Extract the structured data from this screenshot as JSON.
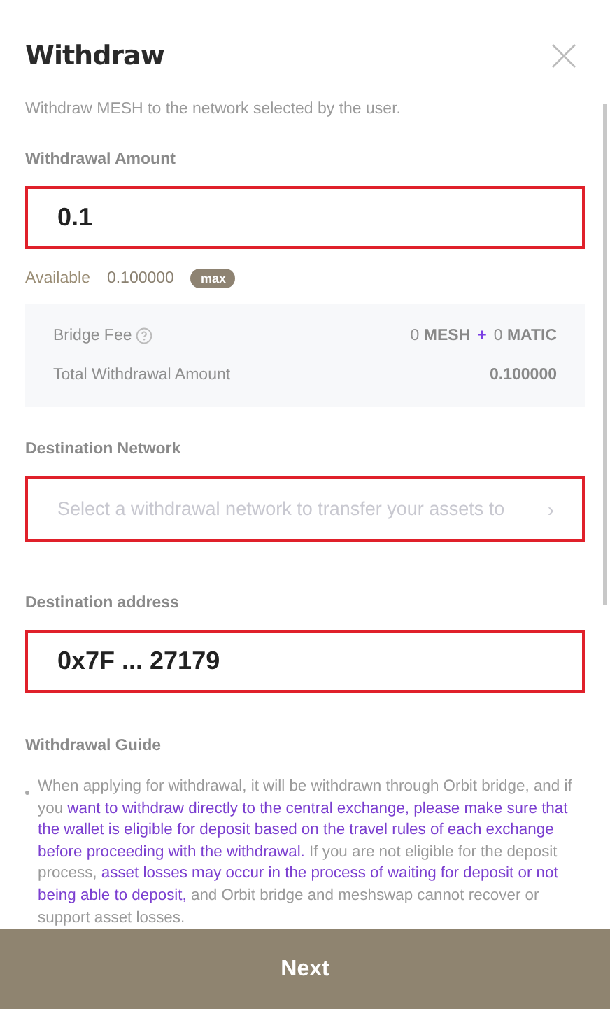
{
  "header": {
    "title": "Withdraw",
    "subtitle": "Withdraw MESH to the network selected by the user."
  },
  "amount": {
    "label": "Withdrawal Amount",
    "value": "0.1",
    "outlined": true,
    "available_label": "Available",
    "available_value": "0.100000",
    "max_button": "max"
  },
  "fees": [
    {
      "kind": "fee",
      "label": "Bridge Fee",
      "value_1": "0 **MESH**",
      "plus": "+",
      "value_2": "0 **MATIC**"
    },
    {
      "kind": "total",
      "label": "Total Withdrawal Amount",
      "value": "0.100000"
    }
  ],
  "network": {
    "label": "Destination Network",
    "placeholder": "Select a withdrawal network to transfer your assets to",
    "chevron": "›",
    "outlined": true
  },
  "address": {
    "label": "Destination address",
    "value": "0x7F ... 27179",
    "outlined": true
  },
  "guide": {
    "title": "Withdrawal Guide",
    "items": [
      {
        "segments": [
          {
            "text": "When applying for withdrawal, it will be withdrawn through Orbit bridge, and if you ",
            "highlight": false
          },
          {
            "text": "want to withdraw directly to the central exchange, please make sure that the wallet is eligible for deposit based on the travel rules of each exchange before proceeding with the withdrawal.",
            "highlight": true
          },
          {
            "text": " If you are not eligible for the deposit process, ",
            "highlight": false
          },
          {
            "text": "asset losses may occur in the process of waiting for deposit or not being able to deposit,",
            "highlight": true
          },
          {
            "text": " and Orbit bridge and meshswap cannot recover or support asset losses.",
            "highlight": false
          }
        ]
      }
    ]
  },
  "next_button": "Next"
}
